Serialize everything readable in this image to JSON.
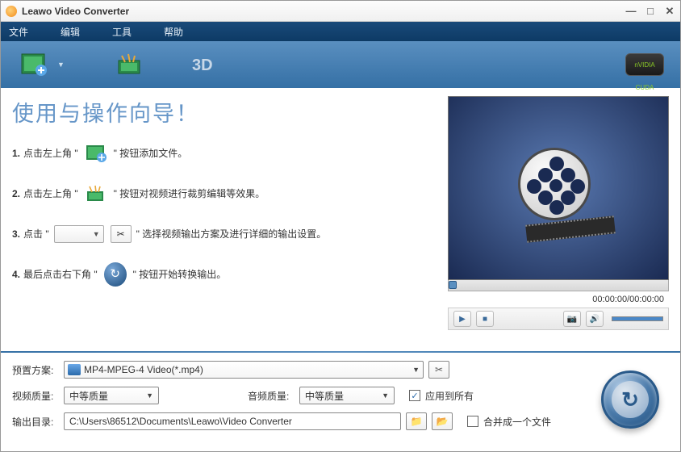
{
  "title": "Leawo Video Converter",
  "menu": {
    "file": "文件",
    "edit": "编辑",
    "tools": "工具",
    "help": "帮助"
  },
  "toolbar": {
    "cuda": "nVIDIA CUDA",
    "threeD": "3D"
  },
  "guide": {
    "title": "使用与操作向导！",
    "step1_a": "1.",
    "step1_b": "点击左上角 \"",
    "step1_c": "\" 按钮添加文件。",
    "step2_a": "2.",
    "step2_b": "点击左上角 \"",
    "step2_c": "\" 按钮对视频进行裁剪编辑等效果。",
    "step3_a": "3.",
    "step3_b": "点击 \"",
    "step3_c": "\" 选择视频输出方案及进行详细的输出设置。",
    "step4_a": "4.",
    "step4_b": "最后点击右下角 \"",
    "step4_c": "\" 按钮开始转换输出。"
  },
  "preview": {
    "time_current": "00:00:00",
    "time_sep": " / ",
    "time_total": "00:00:00"
  },
  "form": {
    "preset_label": "预置方案:",
    "preset_value": "MP4-MPEG-4 Video(*.mp4)",
    "video_q_label": "视频质量:",
    "video_q_value": "中等质量",
    "audio_q_label": "音频质量:",
    "audio_q_value": "中等质量",
    "apply_all": "应用到所有",
    "output_label": "输出目录:",
    "output_value": "C:\\Users\\86512\\Documents\\Leawo\\Video Converter",
    "merge": "合并成一个文件",
    "checked": "✓"
  }
}
